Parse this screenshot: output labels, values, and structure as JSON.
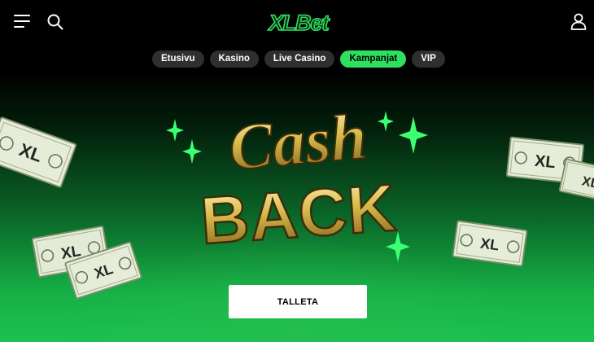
{
  "header": {
    "logo_text": "XLBet",
    "menu_icon": "hamburger-menu-icon",
    "search_icon": "search-icon",
    "user_icon": "user-icon"
  },
  "nav": {
    "tabs": [
      {
        "label": "Etusivu",
        "active": false
      },
      {
        "label": "Kasino",
        "active": false
      },
      {
        "label": "Live Casino",
        "active": false
      },
      {
        "label": "Kampanjat",
        "active": true
      },
      {
        "label": "VIP",
        "active": false
      }
    ]
  },
  "hero": {
    "headline_top": "Cash",
    "headline_bottom": "BACK",
    "bill_text": "XL",
    "cta_label": "TALLETA"
  },
  "colors": {
    "accent": "#2ee05f",
    "background": "#000000",
    "pill_bg": "#2f2f2f",
    "gold": "#d8b94a"
  }
}
